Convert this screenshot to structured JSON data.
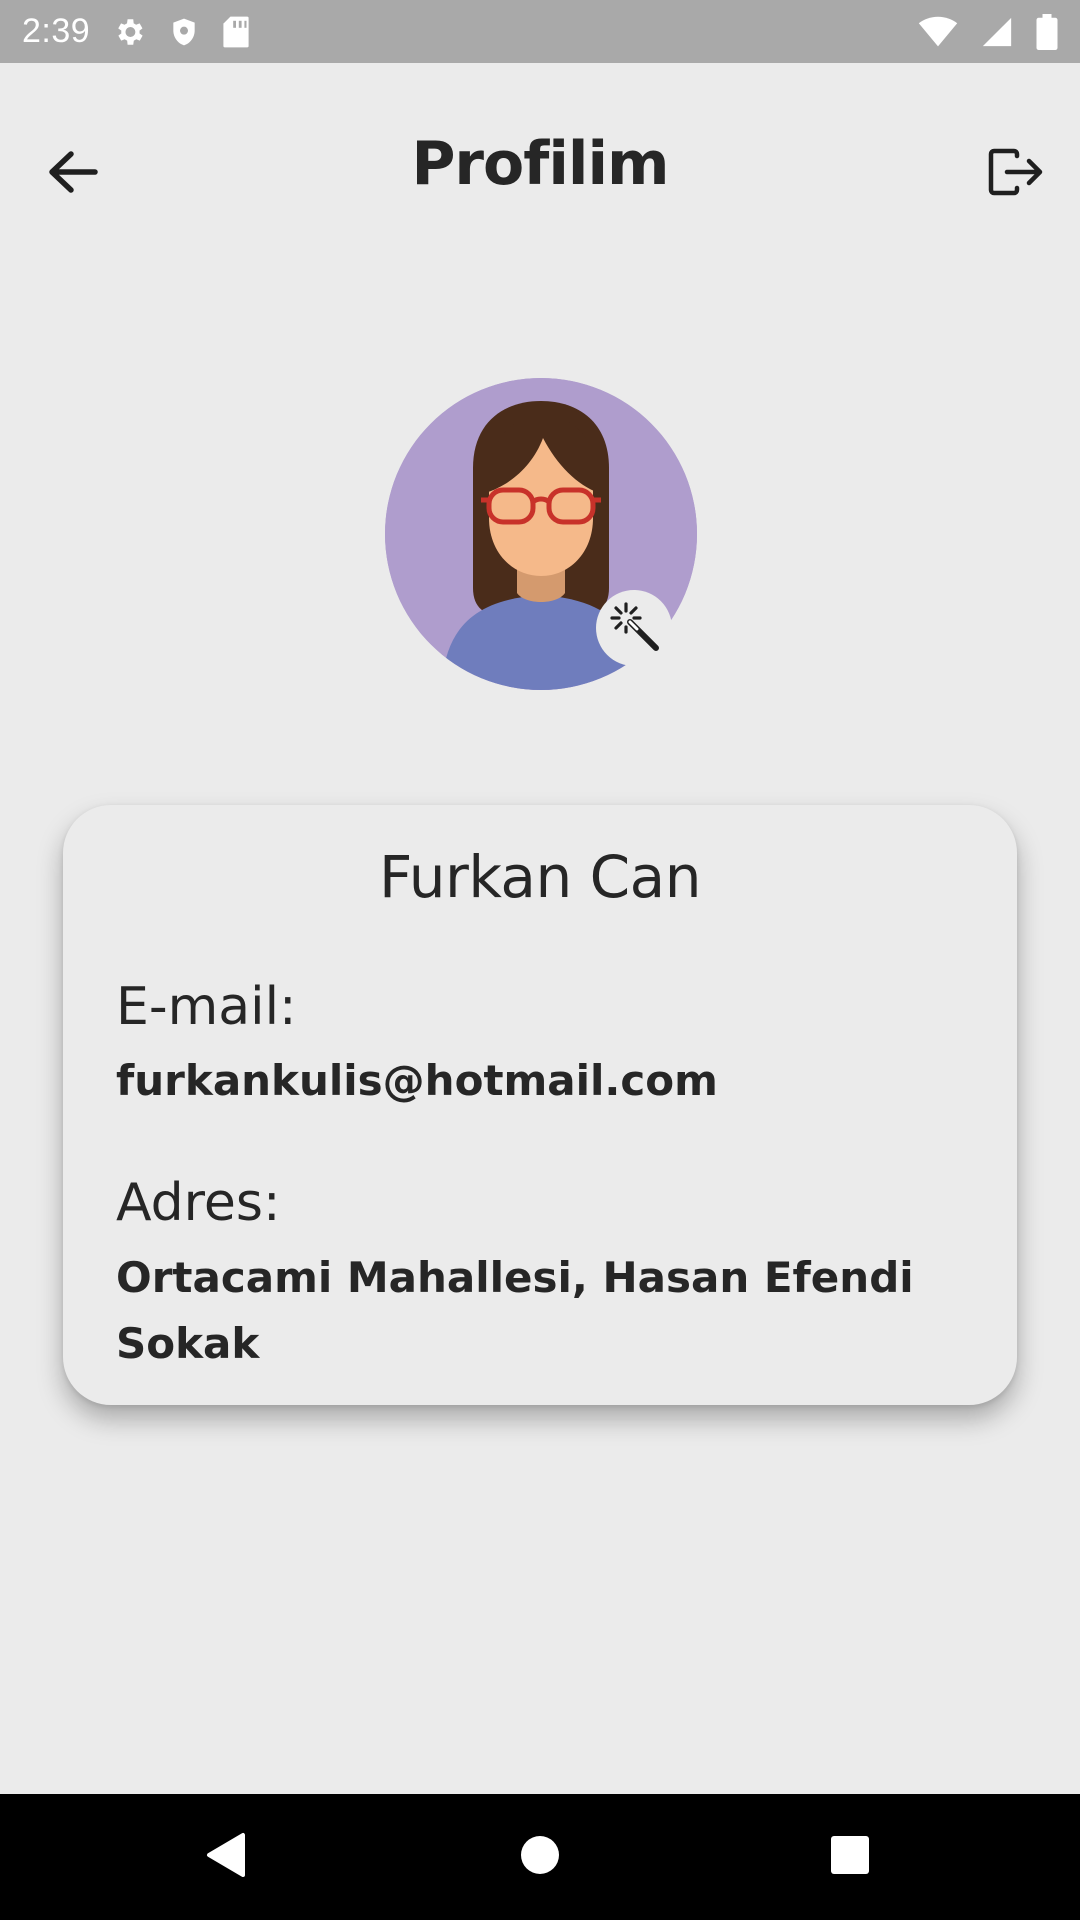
{
  "status_bar": {
    "time": "2:39",
    "left_icons": [
      "gear-icon",
      "shield-icon",
      "sd-card-icon"
    ],
    "right_icons": [
      "wifi-icon",
      "cellular-signal-icon",
      "battery-icon"
    ],
    "background": "#a9a9a9"
  },
  "header": {
    "title": "Profilim",
    "back_icon": "arrow-left-icon",
    "logout_icon": "logout-icon"
  },
  "profile": {
    "avatar_icon": "woman-with-glasses-avatar",
    "edit_icon": "magic-wand-icon",
    "name": "Furkan Can",
    "email_label": "E-mail:",
    "email": "furkankulis@hotmail.com",
    "address_label": "Adres:",
    "address": "Ortacami Mahallesi, Hasan Efendi Sokak"
  },
  "nav_bar": {
    "items": [
      "back-triangle-icon",
      "home-circle-icon",
      "recents-square-icon"
    ]
  },
  "colors": {
    "background": "#ebebeb",
    "avatar_bg": "#af9dcd",
    "shirt": "#6f7dbd",
    "hair": "#4a2c1a",
    "skin": "#f5b98a",
    "glasses": "#c8322a"
  }
}
